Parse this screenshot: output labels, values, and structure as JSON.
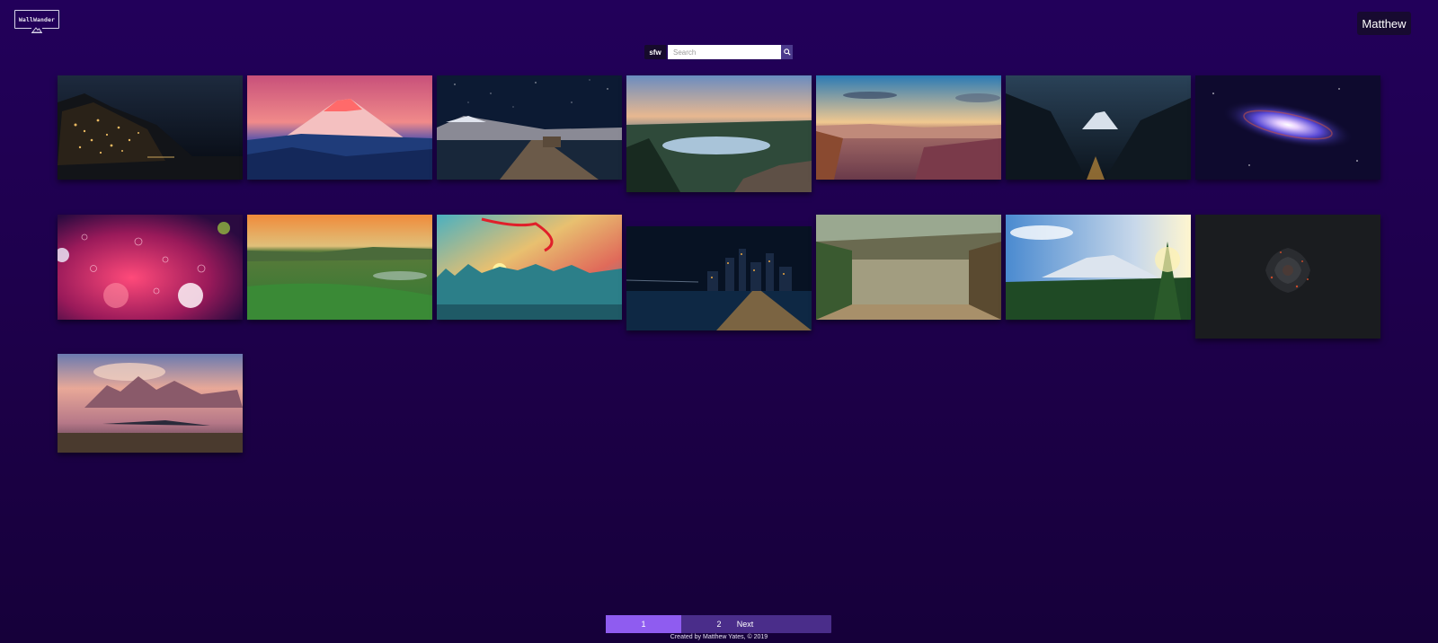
{
  "app": {
    "logo_text": "WallWander",
    "user_name": "Matthew"
  },
  "search": {
    "filter_label": "sfw",
    "placeholder": "Search"
  },
  "wallpapers": [
    {
      "subject": "coastal-village-night",
      "colors": [
        "#0b0f1a",
        "#c9a45a"
      ]
    },
    {
      "subject": "snow-peak-pink-sky",
      "colors": [
        "#e86a8a",
        "#1d3c7a"
      ]
    },
    {
      "subject": "pier-starry-lake",
      "colors": [
        "#0d1a33",
        "#6b5a49"
      ]
    },
    {
      "subject": "crater-lake-dusk",
      "colors": [
        "#8ba9c9",
        "#28402e"
      ]
    },
    {
      "subject": "canyon-sunset",
      "colors": [
        "#2f7fb5",
        "#8a5a6a"
      ]
    },
    {
      "subject": "valley-mountain-night",
      "colors": [
        "#1a2f44",
        "#0c141d"
      ]
    },
    {
      "subject": "galaxy",
      "colors": [
        "#0e0a2e",
        "#5a4ad6"
      ]
    },
    {
      "subject": "raindrops-neon",
      "colors": [
        "#c5205a",
        "#3a0a4a"
      ]
    },
    {
      "subject": "green-hills-sunset",
      "colors": [
        "#e08035",
        "#2f7a32"
      ]
    },
    {
      "subject": "painted-city-sky",
      "colors": [
        "#e2b04a",
        "#2c7f89"
      ]
    },
    {
      "subject": "city-bridge-night",
      "colors": [
        "#071223",
        "#e0a040"
      ]
    },
    {
      "subject": "overgrown-greenhouse",
      "colors": [
        "#8aa37a",
        "#5a4a30"
      ]
    },
    {
      "subject": "alpine-forest-sun",
      "colors": [
        "#6a9ad6",
        "#1f4a25"
      ]
    },
    {
      "subject": "dark-rose",
      "colors": [
        "#1a1c1f",
        "#a8402a"
      ]
    },
    {
      "subject": "mountains-pink-clouds",
      "colors": [
        "#b67888",
        "#3a2a3e"
      ]
    }
  ],
  "pagination": {
    "current": "1",
    "page_2": "2",
    "next": "Next"
  },
  "footer": {
    "text": "Created by Matthew Yates, © 2019"
  }
}
